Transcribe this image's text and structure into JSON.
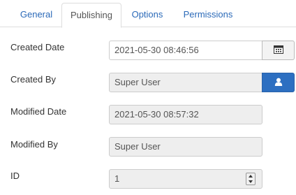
{
  "tabs": [
    {
      "label": "General",
      "active": false
    },
    {
      "label": "Publishing",
      "active": true
    },
    {
      "label": "Options",
      "active": false
    },
    {
      "label": "Permissions",
      "active": false
    }
  ],
  "fields": {
    "created_date": {
      "label": "Created Date",
      "value": "2021-05-30 08:46:56",
      "button_icon": "calendar-icon"
    },
    "created_by": {
      "label": "Created By",
      "value": "Super User",
      "button_icon": "user-icon"
    },
    "modified_date": {
      "label": "Modified Date",
      "value": "2021-05-30 08:57:32"
    },
    "modified_by": {
      "label": "Modified By",
      "value": "Super User"
    },
    "id": {
      "label": "ID",
      "value": "1",
      "control_icon": "number-spinner-icon"
    }
  },
  "colors": {
    "link": "#2a69b8",
    "primary_button": "#2d6fc1",
    "readonly_bg": "#eeeeee",
    "border": "#cccccc"
  }
}
